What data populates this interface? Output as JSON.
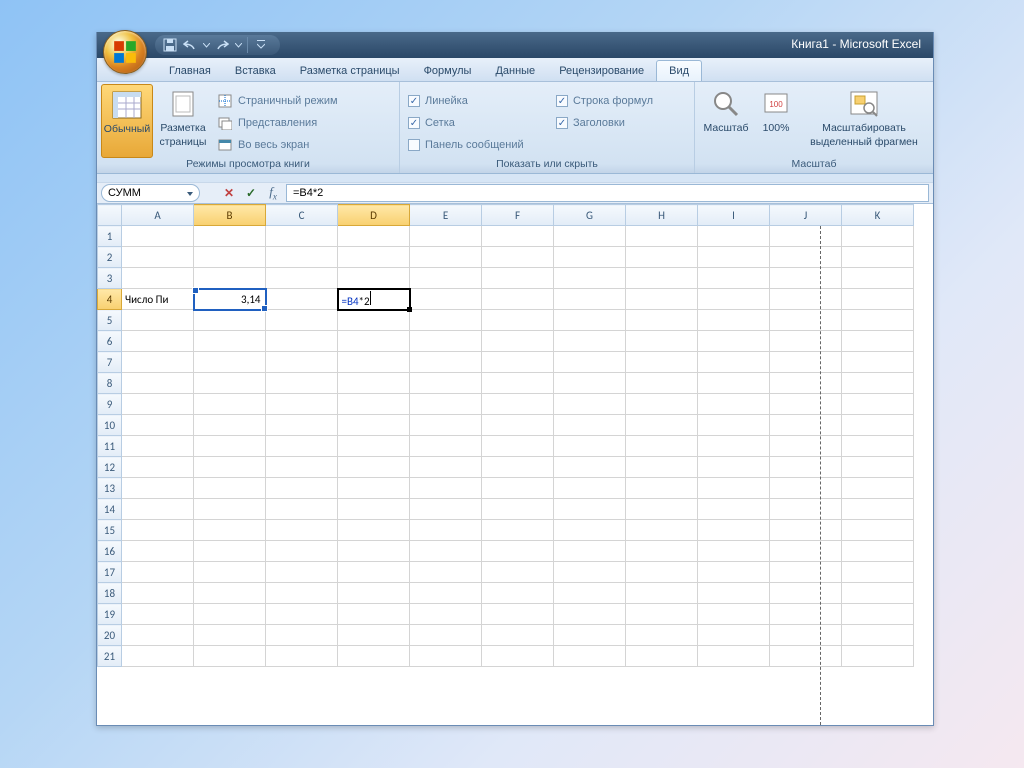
{
  "title": "Книга1 - Microsoft Excel",
  "tabs": {
    "home": "Главная",
    "insert": "Вставка",
    "layout": "Разметка страницы",
    "formulas": "Формулы",
    "data": "Данные",
    "review": "Рецензирование",
    "view": "Вид"
  },
  "ribbon": {
    "views": {
      "normal": "Обычный",
      "pagelayout_1": "Разметка",
      "pagelayout_2": "страницы",
      "pagebreak": "Страничный режим",
      "custom": "Представления",
      "fullscreen": "Во весь экран",
      "group": "Режимы просмотра книги"
    },
    "show": {
      "ruler": "Линейка",
      "grid": "Сетка",
      "msgbar": "Панель сообщений",
      "fbar": "Строка формул",
      "headings": "Заголовки",
      "group": "Показать или скрыть"
    },
    "zoom": {
      "zoom": "Масштаб",
      "hundred": "100%",
      "selection_1": "Масштабировать",
      "selection_2": "выделенный фрагмен",
      "group": "Масштаб"
    }
  },
  "namebox": "СУММ",
  "formula": "=B4*2",
  "columns": [
    "A",
    "B",
    "C",
    "D",
    "E",
    "F",
    "G",
    "H",
    "I",
    "J",
    "K"
  ],
  "rows": [
    1,
    2,
    3,
    4,
    5,
    6,
    7,
    8,
    9,
    10,
    11,
    12,
    13,
    14,
    15,
    16,
    17,
    18,
    19,
    20,
    21
  ],
  "cells": {
    "A4": "Число Пи",
    "B4": "3,14",
    "D4_ref": "=B4",
    "D4_suffix": "*2"
  }
}
